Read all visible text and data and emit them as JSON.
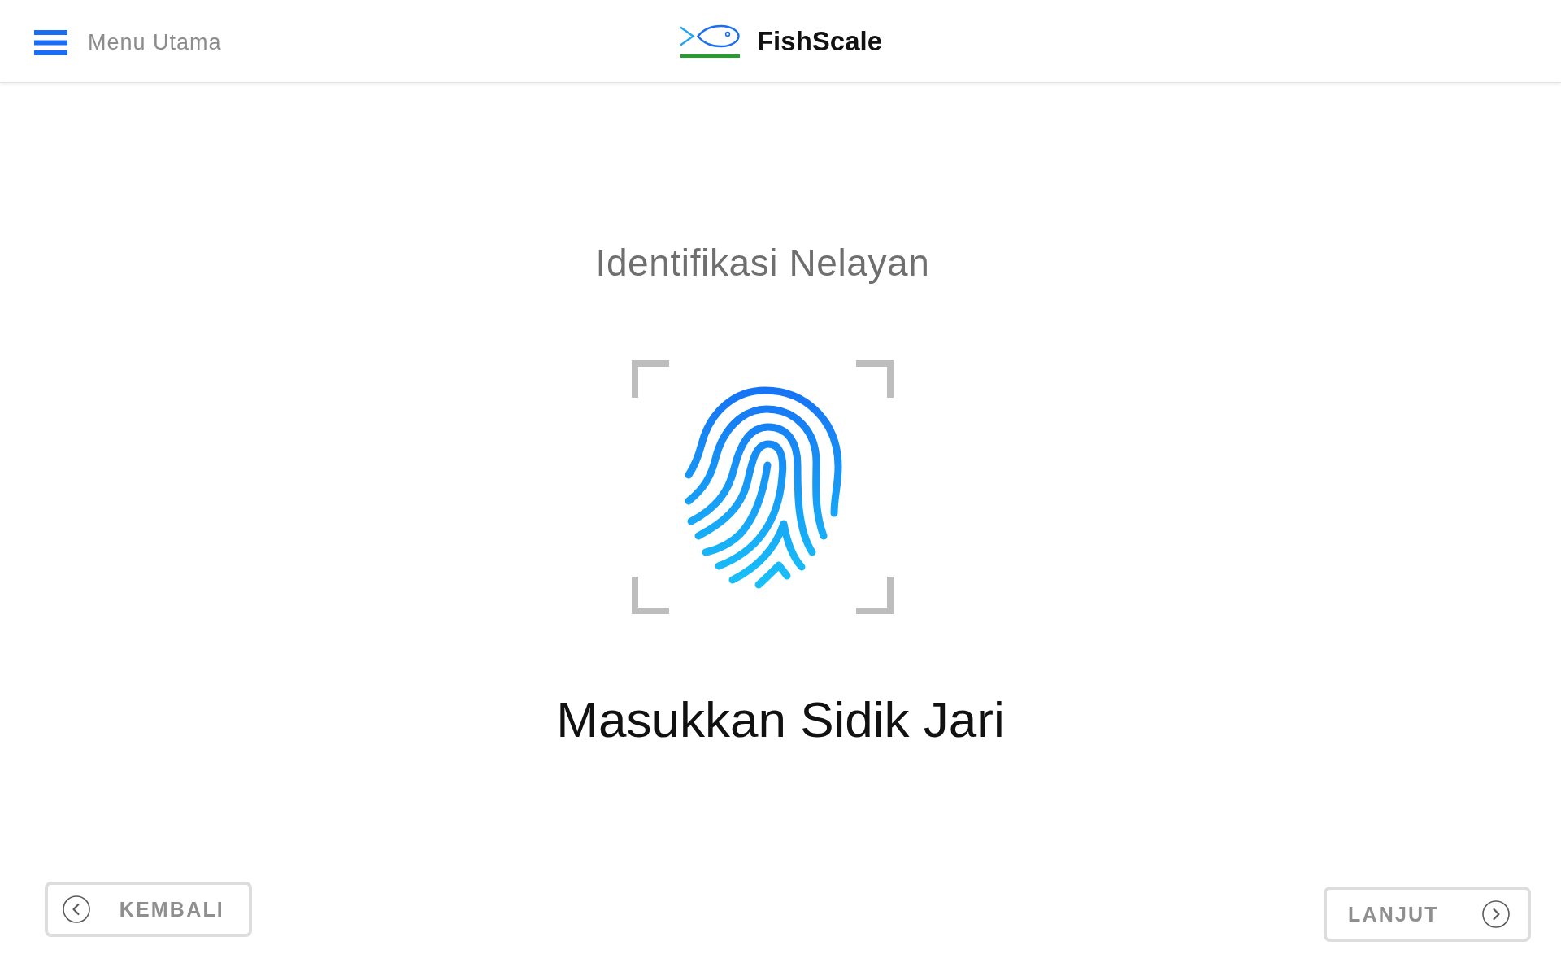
{
  "header": {
    "menu_label": "Menu Utama",
    "app_name": "FishScale"
  },
  "page": {
    "title": "Identifikasi Nelayan",
    "instruction": "Masukkan Sidik Jari"
  },
  "navigation": [
    {
      "label": "KEMBALI",
      "kind": "back"
    },
    {
      "label": "LANJUT",
      "kind": "next"
    }
  ]
}
